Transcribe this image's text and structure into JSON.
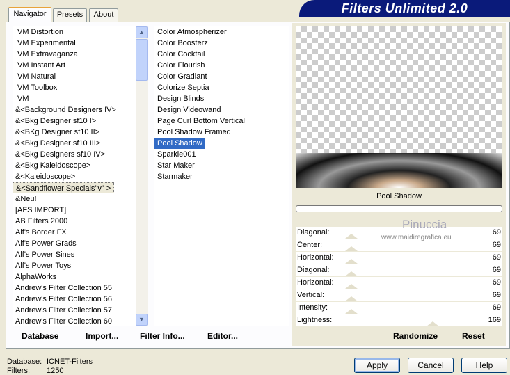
{
  "header": {
    "title": "Filters Unlimited 2.0"
  },
  "tabs": [
    "Navigator",
    "Presets",
    "About"
  ],
  "categories": [
    "VM Distortion",
    "VM Experimental",
    "VM Extravaganza",
    "VM Instant Art",
    "VM Natural",
    "VM Toolbox",
    "VM",
    "&<Background Designers IV>",
    "&<Bkg Designer sf10 I>",
    "&<BKg Designer sf10 II>",
    "&<Bkg Designer sf10 III>",
    "&<Bkg Designers sf10 IV>",
    "&<Bkg Kaleidoscope>",
    "&<Kaleidoscope>",
    "&<Sandflower Specials\"v\" >",
    "&Neu!",
    "[AFS IMPORT]",
    "AB Filters 2000",
    "Alf's Border FX",
    "Alf's Power Grads",
    "Alf's Power Sines",
    "Alf's Power Toys",
    "AlphaWorks",
    "Andrew's Filter Collection 55",
    "Andrew's Filter Collection 56",
    "Andrew's Filter Collection 57",
    "Andrew's Filter Collection 60"
  ],
  "filters": [
    "Color Atmospherizer",
    "Color Boosterz",
    "Color Cocktail",
    "Color Flourish",
    "Color Gradiant",
    "Colorize Septia",
    "Design Blinds",
    "Design Videowand",
    "Page Curl Bottom Vertical",
    "Pool Shadow Framed",
    "Pool Shadow",
    "Sparkle001",
    "Star Maker",
    "Starmaker"
  ],
  "preview": {
    "filter_name": "Pool Shadow",
    "watermark": "Pinuccia",
    "watermark_url": "www.maidiregrafica.eu"
  },
  "params": [
    {
      "label": "Diagonal:",
      "value": "69"
    },
    {
      "label": "Center:",
      "value": "69"
    },
    {
      "label": "Horizontal:",
      "value": "69"
    },
    {
      "label": "Diagonal:",
      "value": "69"
    },
    {
      "label": "Horizontal:",
      "value": "69"
    },
    {
      "label": "Vertical:",
      "value": "69"
    },
    {
      "label": "Intensity:",
      "value": "69"
    },
    {
      "label": "Lightness:",
      "value": "169"
    }
  ],
  "param_max": 255,
  "buttons": {
    "database": "Database",
    "import": "Import...",
    "filter_info": "Filter Info...",
    "editor": "Editor...",
    "randomize": "Randomize",
    "reset": "Reset",
    "apply": "Apply",
    "cancel": "Cancel",
    "help": "Help"
  },
  "status": {
    "database_label": "Database:",
    "database_value": "ICNET-Filters",
    "filters_label": "Filters:",
    "filters_value": "1250"
  }
}
